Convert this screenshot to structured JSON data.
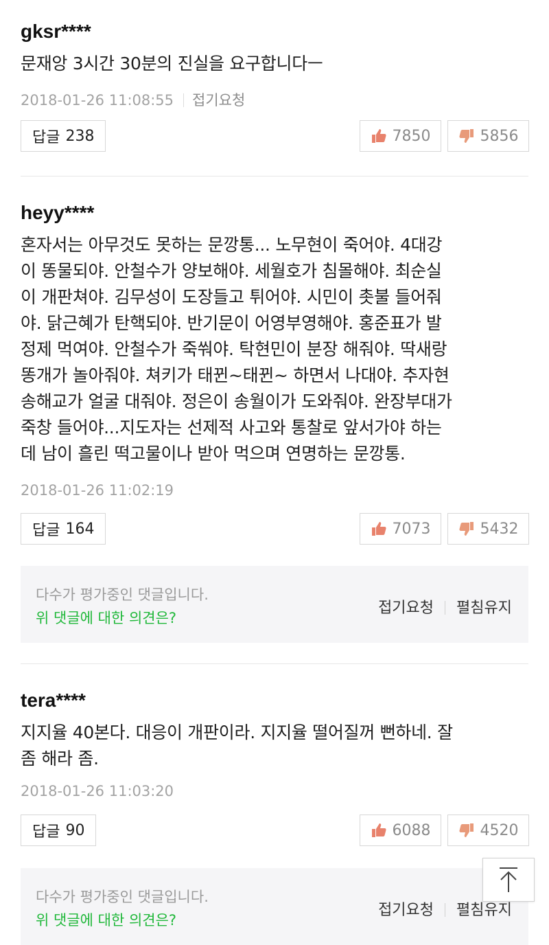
{
  "comments": [
    {
      "user": "gksr****",
      "text": "문재앙 3시간 30분의 진실을 요구합니다ㅡ",
      "time": "2018-01-26 11:08:55",
      "collapse_label": "접기요청",
      "reply_label": "답글",
      "reply_count": "238",
      "likes": "7850",
      "dislikes": "5856"
    },
    {
      "user": "heyy****",
      "text_lines": [
        "혼자서는 아무것도 못하는 문깡통... 노무현이 죽어야. 4대강",
        "이 똥물되야. 안철수가 양보해야. 세월호가 침몰해야. 최순실",
        "이 개판쳐야. 김무성이 도장들고 튀어야. 시민이 촛불 들어줘",
        "야. 닭근혜가 탄핵되야. 반기문이 어영부영해야. 홍준표가 발",
        "정제 먹여야. 안철수가 죽쒀야. 탁현민이 분장 해줘야. 딱새랑",
        "똥개가 놀아줘야. 쳐키가 태뀐~태뀐~ 하면서 나대야. 추자현",
        "송해교가 얼굴 대줘야. 정은이 송월이가 도와줘야. 완장부대가",
        "죽창 들어야...지도자는 선제적 사고와 통찰로 앞서가야 하는",
        "데 남이 흘린 떡고물이나 받아 먹으며 연명하는 문깡통."
      ],
      "time": "2018-01-26 11:02:19",
      "reply_label": "답글",
      "reply_count": "164",
      "likes": "7073",
      "dislikes": "5432"
    },
    {
      "user": "tera****",
      "text_lines": [
        "지지율 40본다. 대응이 개판이라. 지지율 떨어질꺼 뻔하네. 잘",
        "좀 해라 좀."
      ],
      "time": "2018-01-26 11:03:20",
      "reply_label": "답글",
      "reply_count": "90",
      "likes": "6088",
      "dislikes": "4520"
    }
  ],
  "notice": {
    "line1": "다수가 평가중인 댓글입니다.",
    "line2": "위 댓글에 대한 의견은?",
    "collapse_request": "접기요청",
    "keep_open": "펼침유지"
  },
  "colors": {
    "accent_green": "#20b83a",
    "thumb_up": "#e8826c",
    "thumb_down": "#e89a7a"
  },
  "icons": [
    "thumbs-up-icon",
    "thumbs-down-icon",
    "arrow-up-icon"
  ]
}
